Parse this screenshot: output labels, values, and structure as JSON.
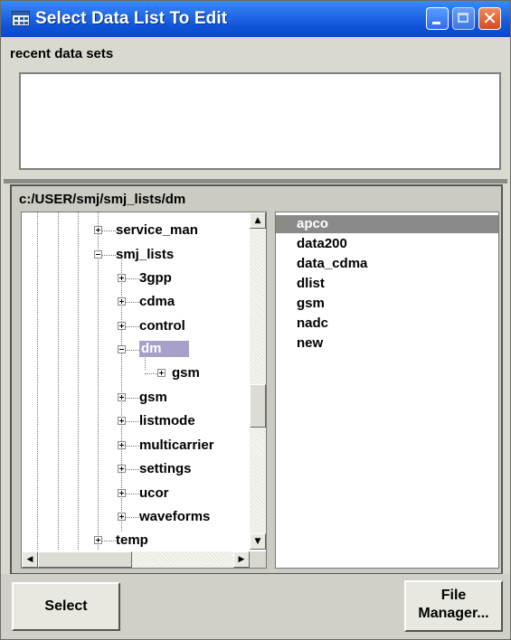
{
  "window": {
    "title": "Select Data List To Edit"
  },
  "recent": {
    "label": "recent data sets"
  },
  "browser": {
    "path": "c:/USER/smj/smj_lists/dm",
    "tree": [
      {
        "label": "service_man"
      },
      {
        "label": "smj_lists"
      },
      {
        "label": "3gpp"
      },
      {
        "label": "cdma"
      },
      {
        "label": "control"
      },
      {
        "label": "dm"
      },
      {
        "label": "gsm"
      },
      {
        "label": "gsm"
      },
      {
        "label": "listmode"
      },
      {
        "label": "multicarrier"
      },
      {
        "label": "settings"
      },
      {
        "label": "ucor"
      },
      {
        "label": "waveforms"
      },
      {
        "label": "temp"
      }
    ],
    "files": [
      "apco",
      "data200",
      "data_cdma",
      "dlist",
      "gsm",
      "nadc",
      "new"
    ],
    "selected_file": "apco"
  },
  "buttons": {
    "select": "Select",
    "file_manager_line1": "File",
    "file_manager_line2": "Manager..."
  },
  "scroll": {
    "up_arrow": "▲",
    "down_arrow": "▼",
    "left_arrow": "◀",
    "right_arrow": "▶"
  },
  "icons": {
    "close": "✕"
  },
  "colors": {
    "title_bar": "#1f67e6",
    "selection": "#8a8a86",
    "tree_selection": "#a7a0c9"
  }
}
